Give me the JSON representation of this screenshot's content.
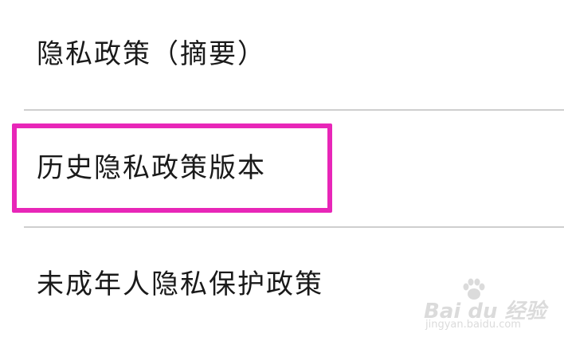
{
  "menu": {
    "items": [
      {
        "label": "隐私政策（摘要）"
      },
      {
        "label": "历史隐私政策版本",
        "highlighted": true
      },
      {
        "label": "未成年人隐私保护政策"
      }
    ]
  },
  "highlight": {
    "color": "#e826b8"
  },
  "watermark": {
    "brand": "Bai du 经验",
    "url": "jingyan.baidu.com"
  }
}
